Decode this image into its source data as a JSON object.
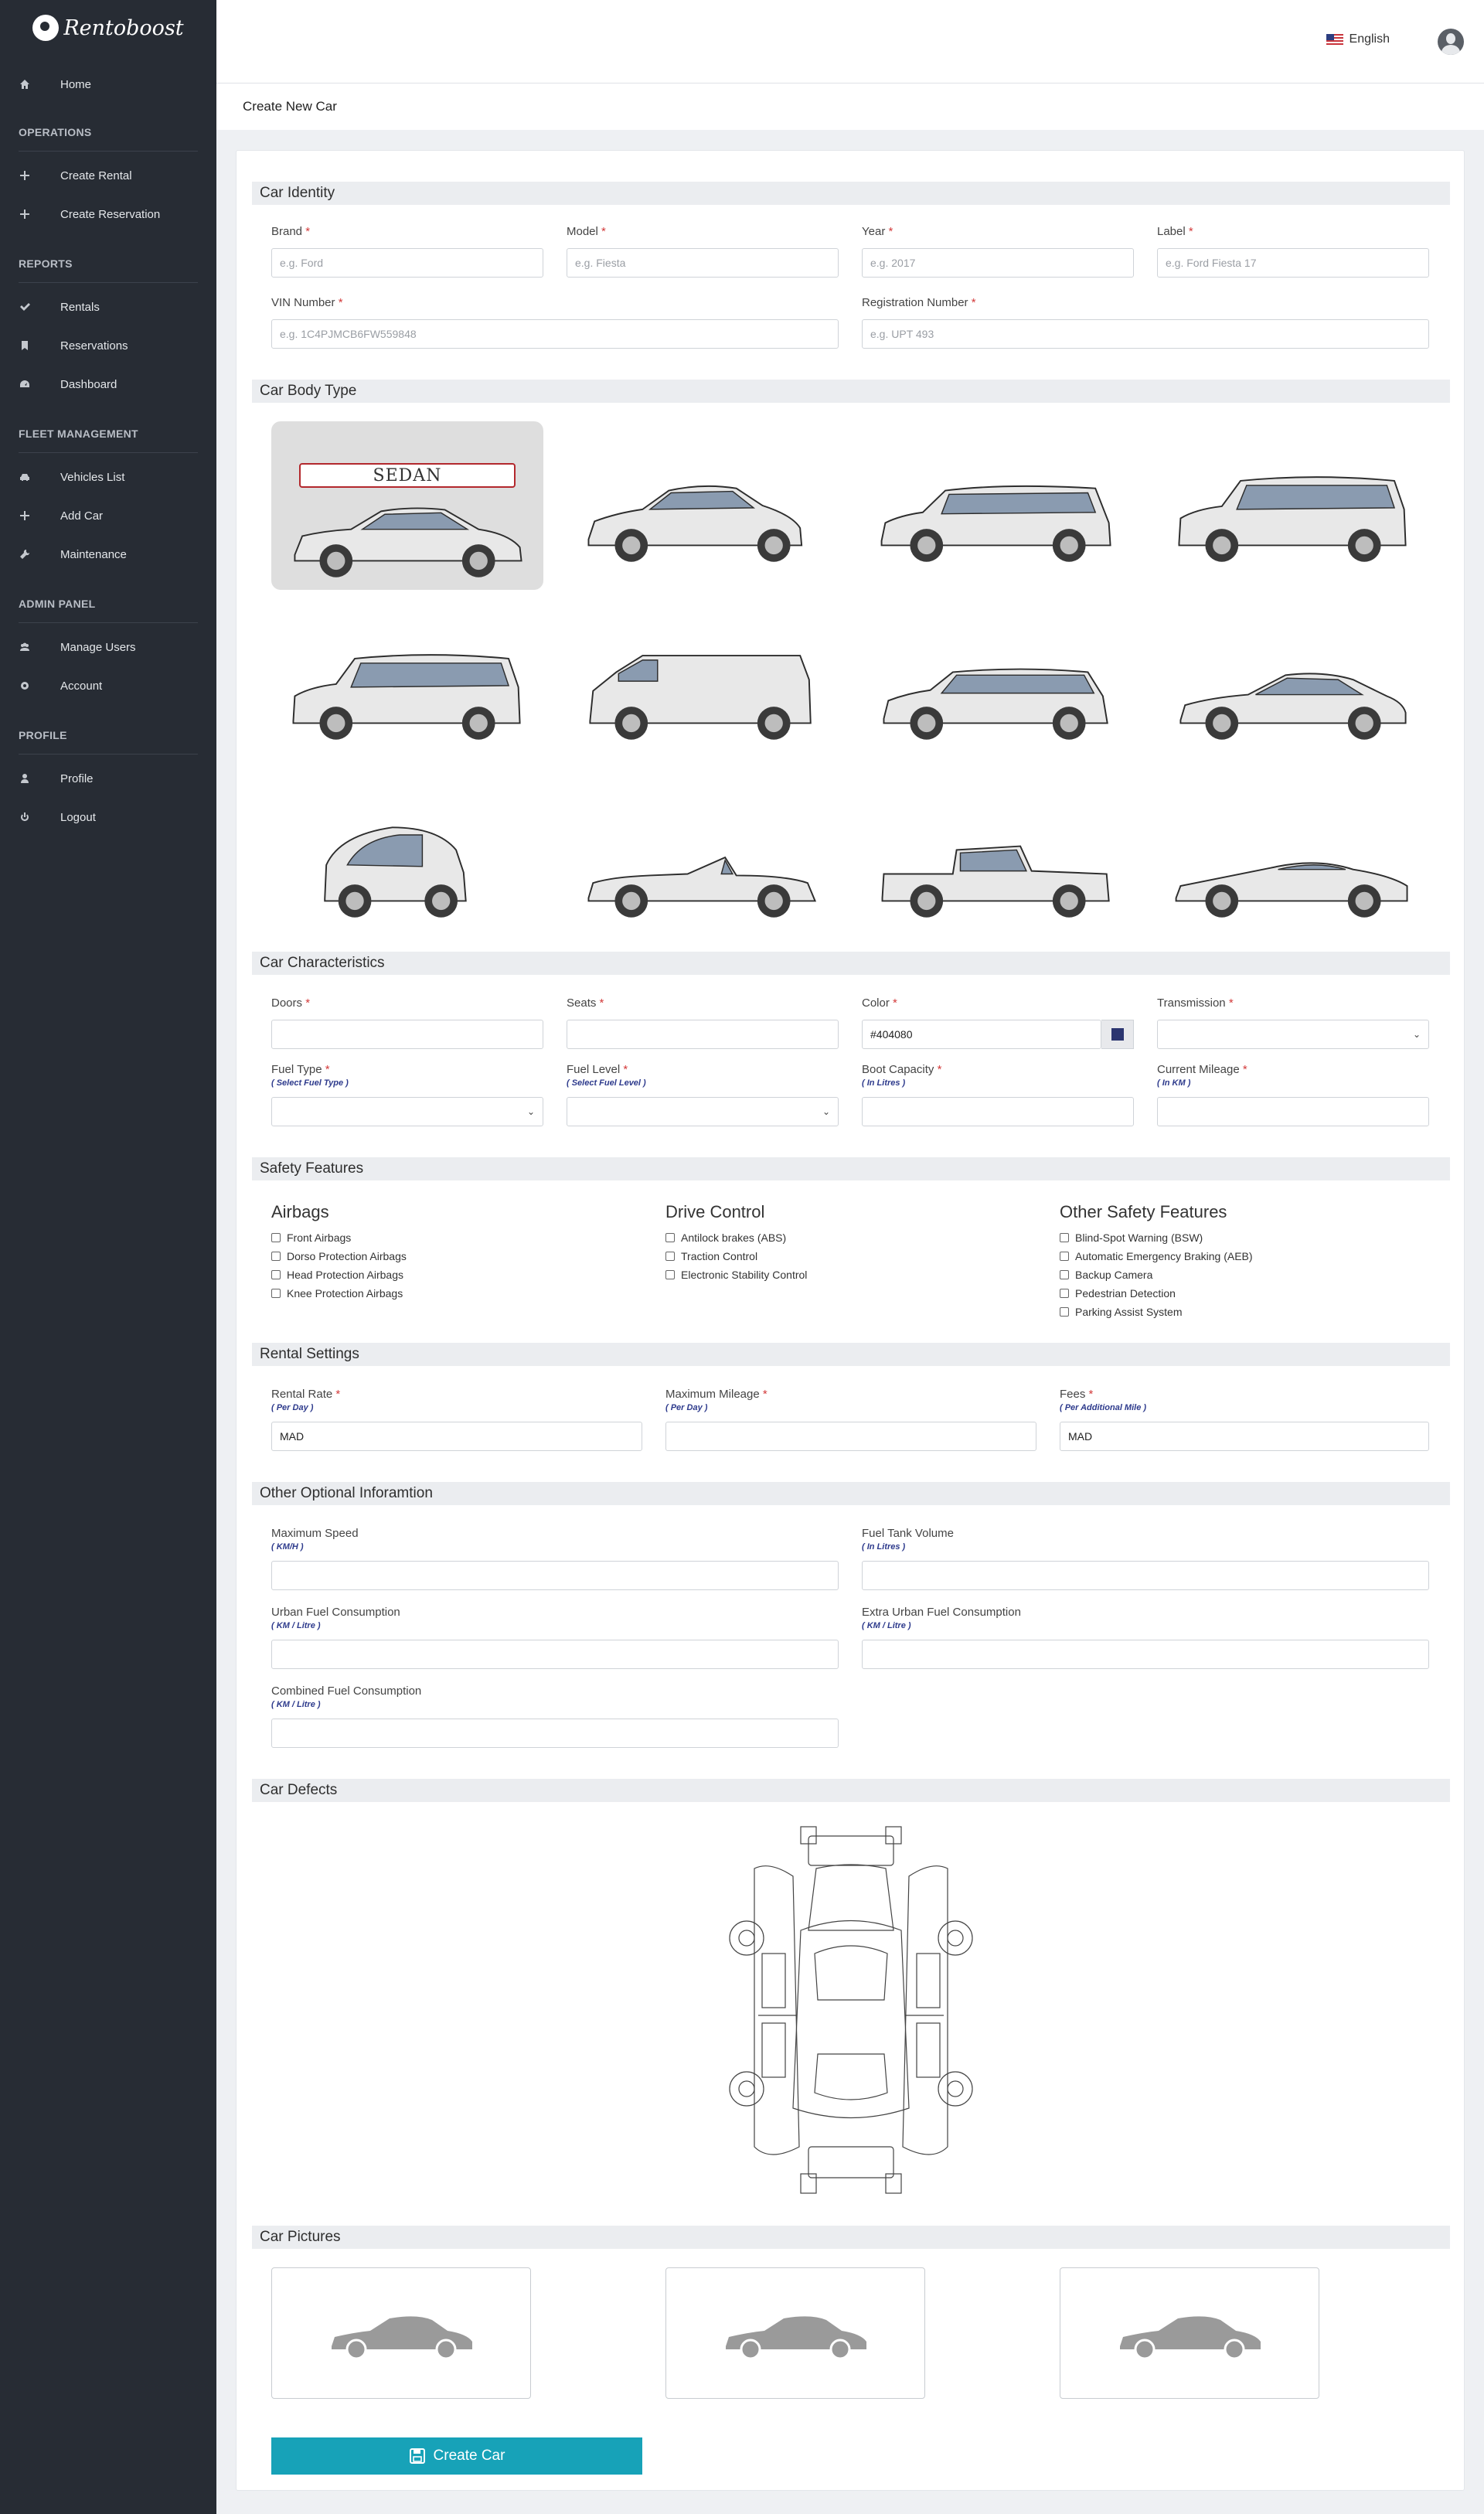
{
  "app": {
    "name": "Rentoboost"
  },
  "sidebar": {
    "home": "Home",
    "sections": [
      {
        "title": "OPERATIONS",
        "items": [
          {
            "label": "Create Rental",
            "icon": "plus-icon"
          },
          {
            "label": "Create Reservation",
            "icon": "plus-icon"
          }
        ]
      },
      {
        "title": "REPORTS",
        "items": [
          {
            "label": "Rentals",
            "icon": "check-icon"
          },
          {
            "label": "Reservations",
            "icon": "bookmark-icon"
          },
          {
            "label": "Dashboard",
            "icon": "dashboard-icon"
          }
        ]
      },
      {
        "title": "FLEET MANAGEMENT",
        "items": [
          {
            "label": "Vehicles List",
            "icon": "car-icon"
          },
          {
            "label": "Add Car",
            "icon": "plus-icon"
          },
          {
            "label": "Maintenance",
            "icon": "wrench-icon"
          }
        ]
      },
      {
        "title": "ADMIN PANEL",
        "items": [
          {
            "label": "Manage Users",
            "icon": "users-icon"
          },
          {
            "label": "Account",
            "icon": "gear-icon"
          }
        ]
      },
      {
        "title": "PROFILE",
        "items": [
          {
            "label": "Profile",
            "icon": "user-icon"
          },
          {
            "label": "Logout",
            "icon": "power-icon"
          }
        ]
      }
    ]
  },
  "topbar": {
    "language": "English"
  },
  "page": {
    "title": "Create New Car"
  },
  "identity": {
    "title": "Car Identity",
    "brand": {
      "label": "Brand",
      "placeholder": "e.g. Ford"
    },
    "model": {
      "label": "Model",
      "placeholder": "e.g. Fiesta"
    },
    "year": {
      "label": "Year",
      "placeholder": "e.g. 2017"
    },
    "carlabel": {
      "label": "Label",
      "placeholder": "e.g. Ford Fiesta 17"
    },
    "vin": {
      "label": "VIN Number",
      "placeholder": "e.g. 1C4PJMCB6FW559848"
    },
    "reg": {
      "label": "Registration Number",
      "placeholder": "e.g. UPT 493"
    }
  },
  "bodytype": {
    "title": "Car Body Type",
    "selected_label": "SEDAN"
  },
  "characteristics": {
    "title": "Car Characteristics",
    "doors": "Doors",
    "seats": "Seats",
    "color": "Color",
    "color_value": "#404080",
    "transmission": "Transmission",
    "fuel_type": "Fuel Type",
    "fuel_type_sub": "( Select Fuel Type )",
    "fuel_level": "Fuel Level",
    "fuel_level_sub": "( Select Fuel Level )",
    "boot": "Boot Capacity",
    "boot_sub": "( In Litres )",
    "mileage": "Current Mileage",
    "mileage_sub": "( In KM )"
  },
  "safety": {
    "title": "Safety Features",
    "airbags": {
      "title": "Airbags",
      "items": [
        "Front Airbags",
        "Dorso Protection Airbags",
        "Head Protection Airbags",
        "Knee Protection Airbags"
      ]
    },
    "drive": {
      "title": "Drive Control",
      "items": [
        "Antilock brakes (ABS)",
        "Traction Control",
        "Electronic Stability Control"
      ]
    },
    "other": {
      "title": "Other Safety Features",
      "items": [
        "Blind-Spot Warning (BSW)",
        "Automatic Emergency Braking (AEB)",
        "Backup Camera",
        "Pedestrian Detection",
        "Parking Assist System"
      ]
    }
  },
  "rental": {
    "title": "Rental Settings",
    "rate": "Rental Rate",
    "rate_sub": "( Per Day )",
    "rate_value": "MAD",
    "maxmile": "Maximum Mileage",
    "maxmile_sub": "( Per Day )",
    "fees": "Fees",
    "fees_sub": "( Per Additional Mile )",
    "fees_value": "MAD"
  },
  "optional": {
    "title": "Other Optional Inforamtion",
    "maxspeed": "Maximum Speed",
    "maxspeed_sub": "( KM/H )",
    "tank": "Fuel Tank Volume",
    "tank_sub": "( In Litres )",
    "urban": "Urban Fuel Consumption",
    "urban_sub": "( KM / Litre )",
    "extra": "Extra Urban Fuel Consumption",
    "extra_sub": "( KM / Litre )",
    "combined": "Combined Fuel Consumption",
    "combined_sub": "( KM / Litre )"
  },
  "defects": {
    "title": "Car Defects"
  },
  "pictures": {
    "title": "Car Pictures"
  },
  "actions": {
    "create": "Create Car"
  }
}
